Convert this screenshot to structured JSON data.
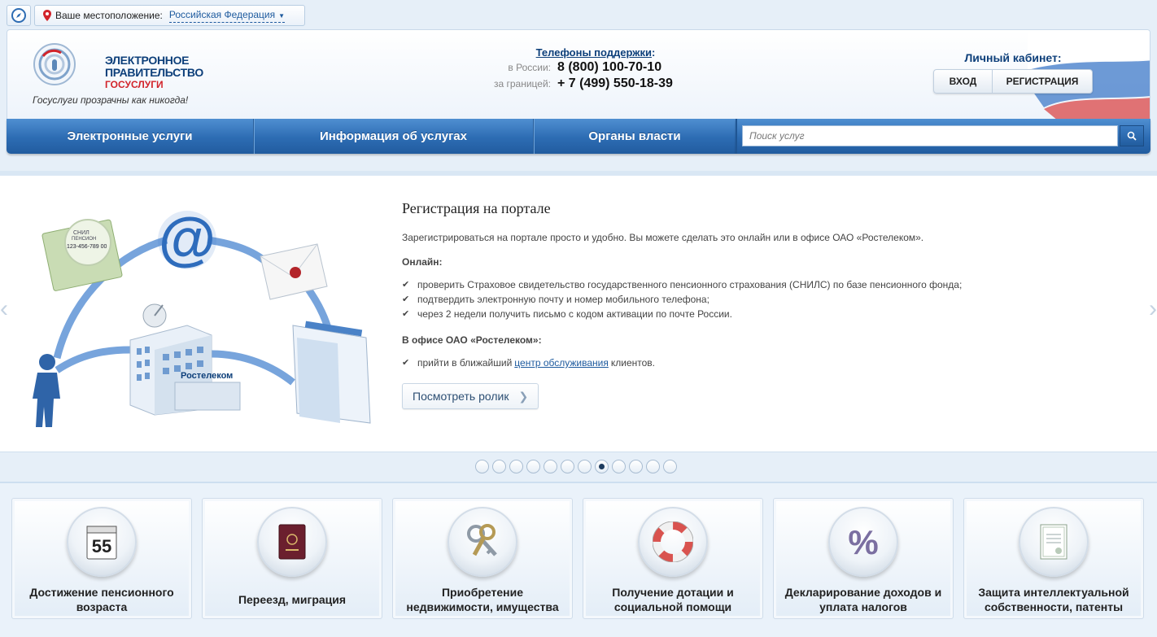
{
  "location": {
    "label": "Ваше местоположение:",
    "value": "Российская Федерация"
  },
  "logo": {
    "line1": "ЭЛЕКТРОННОЕ",
    "line2": "ПРАВИТЕЛЬСТВО",
    "line3": "ГОСУСЛУГИ",
    "slogan": "Госуслуги прозрачны как никогда!"
  },
  "support": {
    "title": "Телефоны поддержки",
    "colon": ":",
    "russia_label": "в России:",
    "russia_phone": "8 (800) 100-70-10",
    "abroad_label": "за границей:",
    "abroad_phone": "+ 7 (499) 550-18-39"
  },
  "cabinet": {
    "title": "Личный кабинет:",
    "login": "ВХОД",
    "register": "РЕГИСТРАЦИЯ"
  },
  "nav": {
    "items": [
      "Электронные услуги",
      "Информация об услугах",
      "Органы власти"
    ]
  },
  "search": {
    "placeholder": "Поиск услуг"
  },
  "slide": {
    "title": "Регистрация на портале",
    "intro": "Зарегистрироваться на портале просто и удобно. Вы можете сделать это онлайн или в офисе ОАО «Ростелеком».",
    "online_heading": "Онлайн:",
    "online_items": [
      "проверить Страховое свидетельство государственного пенсионного страхования (СНИЛС) по базе пенсионного фонда;",
      "подтвердить электронную почту и номер мобильного телефона;",
      "через 2 недели получить письмо с кодом активации по почте России."
    ],
    "office_heading": "В офисе ОАО «Ростелеком»:",
    "office_before": "прийти в ближайший",
    "office_link": "центр обслуживания",
    "office_after": "клиентов.",
    "video_button": "Посмотреть ролик",
    "illustration": {
      "snils_title": "СНИЛ",
      "snils_sub": "ПЕНСИОН",
      "snils_number": "123-456-789 00",
      "at_symbol": "@",
      "rostelecom": "Ростелеком"
    }
  },
  "pager": {
    "count": 12,
    "active_index": 7
  },
  "categories": [
    {
      "label": "Достижение пенсионного возраста",
      "icon": "calendar-icon",
      "icon_text": "55"
    },
    {
      "label": "Переезд, миграция",
      "icon": "passport-icon"
    },
    {
      "label": "Приобретение недвижимости, имущества",
      "icon": "keys-icon"
    },
    {
      "label": "Получение дотации и социальной помощи",
      "icon": "lifebuoy-icon"
    },
    {
      "label": "Декларирование доходов и уплата налогов",
      "icon": "percent-icon",
      "icon_text": "%"
    },
    {
      "label": "Защита интеллектуальной собственности, патенты",
      "icon": "certificate-icon"
    }
  ],
  "colors": {
    "brand_blue": "#0d3f7a",
    "nav_blue": "#2d6cb3",
    "accent_red": "#d2232a",
    "link_blue": "#1d5a9e"
  }
}
